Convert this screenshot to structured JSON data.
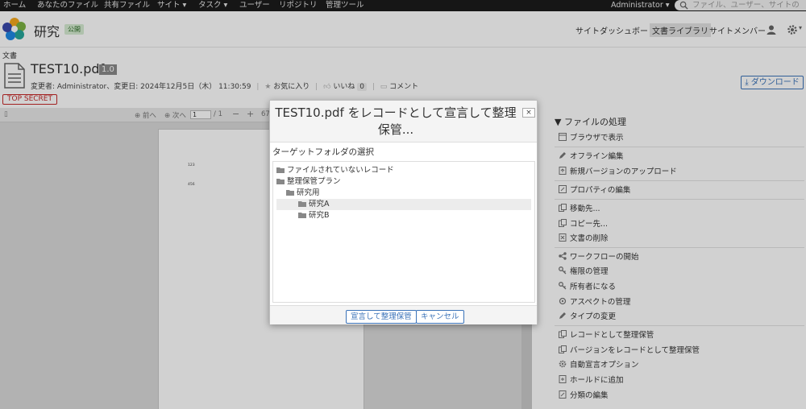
{
  "topnav": {
    "items": [
      "ホーム",
      "あなたのファイル",
      "共有ファイル",
      "サイト",
      "タスク",
      "ユーザー",
      "リポジトリ",
      "管理ツール"
    ],
    "user": "Administrator",
    "search_placeholder": "ファイル、ユーザー、サイトの"
  },
  "site": {
    "title": "研究",
    "visibility": "公開",
    "links": [
      "サイトダッシュボード",
      "文書ライブラリ",
      "サイトメンバー"
    ]
  },
  "document": {
    "section": "文書",
    "title": "TEST10.pdf",
    "version": "1.0",
    "modified": "変更者: Administrator、変更日: 2024年12月5日（木） 11:30:59",
    "favorite": "お気に入り",
    "like": "いいね",
    "like_count": "0",
    "comment": "コメント",
    "classification": "TOP SECRET",
    "download": "ダウンロード"
  },
  "viewer": {
    "prev": "前へ",
    "next": "次へ",
    "page": "1",
    "total": "/ 1",
    "zoom": "67",
    "text1": "123",
    "text2": "456"
  },
  "actions": {
    "title": "▼ ファイルの処理",
    "groups": [
      [
        "ブラウザで表示"
      ],
      [
        "オフライン編集",
        "新規バージョンのアップロード"
      ],
      [
        "プロパティの編集"
      ],
      [
        "移動先...",
        "コピー先...",
        "文書の削除"
      ],
      [
        "ワークフローの開始",
        "権限の管理",
        "所有者になる",
        "アスペクトの管理",
        "タイプの変更"
      ],
      [
        "レコードとして整理保管",
        "バージョンをレコードとして整理保管",
        "自動宣言オプション",
        "ホールドに追加",
        "分類の編集"
      ]
    ]
  },
  "dialog": {
    "title": "TEST10.pdf をレコードとして宣言して整理保管...",
    "close": "×",
    "subtitle": "ターゲットフォルダの選択",
    "tree": [
      {
        "label": "ファイルされていないレコード",
        "depth": 0
      },
      {
        "label": "整理保管プラン",
        "depth": 0
      },
      {
        "label": "研究用",
        "depth": 1
      },
      {
        "label": "研究A",
        "depth": 2,
        "selected": true
      },
      {
        "label": "研究B",
        "depth": 2
      }
    ],
    "confirm": "宣言して整理保管",
    "cancel": "キャンセル"
  }
}
